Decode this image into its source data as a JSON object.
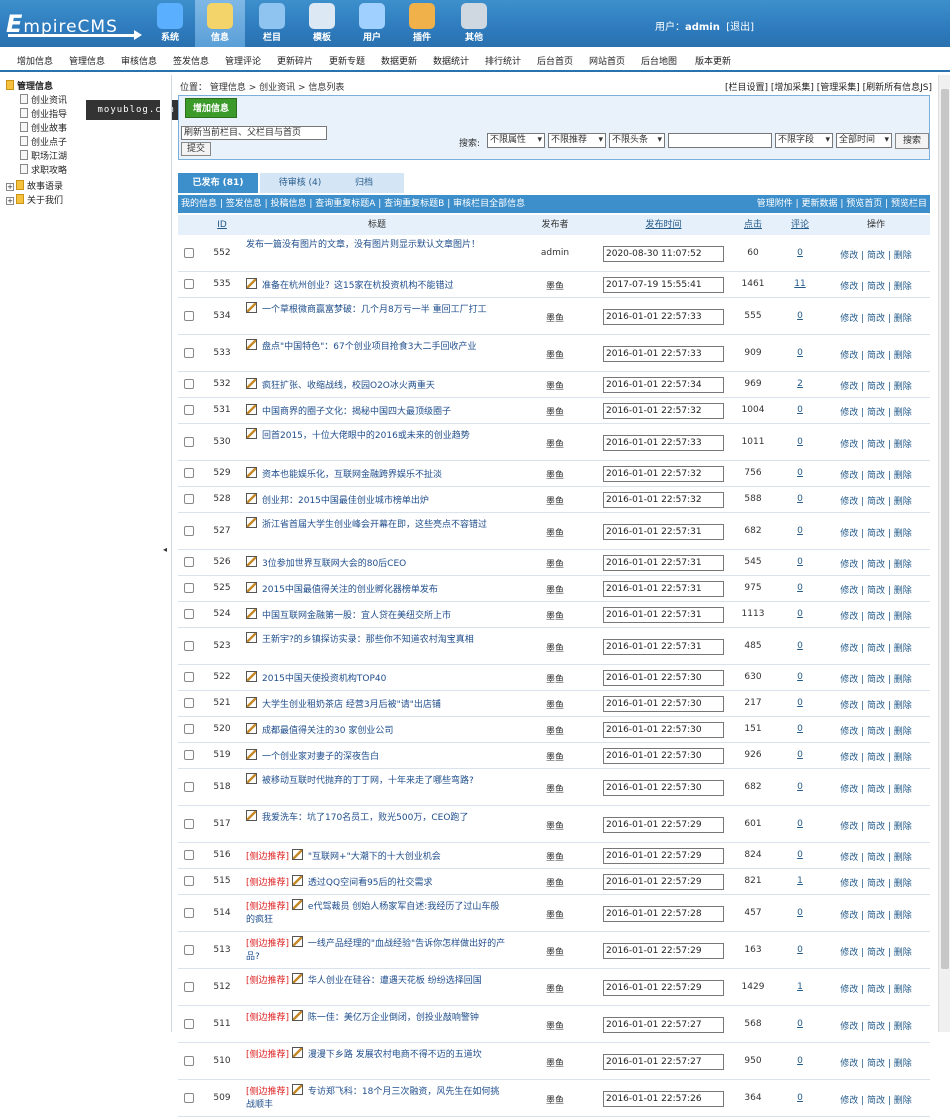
{
  "app": {
    "logo_big": "E",
    "logo_rest": "mpireCMS"
  },
  "nav": [
    {
      "label": "系统",
      "icon": "globe-icon"
    },
    {
      "label": "信息",
      "icon": "document-edit-icon"
    },
    {
      "label": "栏目",
      "icon": "folder-icon"
    },
    {
      "label": "模板",
      "icon": "template-window-icon"
    },
    {
      "label": "用户",
      "icon": "user-icon"
    },
    {
      "label": "插件",
      "icon": "tools-icon"
    },
    {
      "label": "其他",
      "icon": "gear-icon"
    }
  ],
  "user": {
    "prefix": "用户：",
    "name": "admin",
    "logout": "[退出]"
  },
  "menu": [
    "增加信息",
    "管理信息",
    "审核信息",
    "签发信息",
    "管理评论",
    "更新碎片",
    "更新专题",
    "数据更新",
    "数据统计",
    "排行统计",
    "后台首页",
    "网站首页",
    "后台地图",
    "版本更新"
  ],
  "sidebar": {
    "root": "管理信息",
    "items": [
      "创业资讯",
      "创业指导",
      "创业故事",
      "创业点子",
      "职场江湖",
      "求职攻略"
    ],
    "groups": [
      "故事语录",
      "关于我们"
    ]
  },
  "watermark": "moyublog.com",
  "breadcrumb": "位置： 管理信息 > 创业资讯 > 信息列表",
  "crumb_links": "[栏目设置] [增加采集] [管理采集] [刷新所有信息JS]",
  "toolbox": {
    "add_label": "增加信息",
    "category_select": "刷新当前栏目、父栏目与首页",
    "submit": "提交",
    "search_label": "搜索:",
    "filters": [
      "不限属性",
      "不限推荐",
      "不限头条",
      "不限字段",
      "全部时间"
    ],
    "search_value": "",
    "search_button": "搜索"
  },
  "tabs": [
    "已发布 (81)",
    "待审核 (4)",
    "归档"
  ],
  "links_left": "我的信息 | 签发信息 | 投稿信息 | 查询重复标题A | 查询重复标题B | 审核栏目全部信息",
  "links_right": "管理附件 | 更新数据 | 预览首页 | 预览栏目",
  "columns": [
    "ID",
    "标题",
    "发布者",
    "发布时间",
    "点击",
    "评论",
    "操作"
  ],
  "ops": "修改 | 简改 | 删除",
  "rows": [
    {
      "id": "552",
      "title": "发布一篇没有图片的文章，没有图片则显示默认文章图片！",
      "pen": false,
      "tag": "",
      "publisher": "admin",
      "time": "2020-08-30 11:07:52",
      "clicks": "60",
      "comments": "0"
    },
    {
      "id": "535",
      "title": "准备在杭州创业？这15家在杭投资机构不能错过",
      "pen": true,
      "tag": "",
      "publisher": "墨鱼",
      "time": "2017-07-19 15:55:41",
      "clicks": "1461",
      "comments": "11"
    },
    {
      "id": "534",
      "title": "一个草根微商赢富梦破：几个月8万亏一半 重回工厂打工",
      "pen": true,
      "tag": "",
      "publisher": "墨鱼",
      "time": "2016-01-01 22:57:33",
      "clicks": "555",
      "comments": "0"
    },
    {
      "id": "533",
      "title": "盘点\"中国特色\"：67个创业项目抢食3大二手回收产业",
      "pen": true,
      "tag": "",
      "publisher": "墨鱼",
      "time": "2016-01-01 22:57:33",
      "clicks": "909",
      "comments": "0"
    },
    {
      "id": "532",
      "title": "疯狂扩张、收缩战线，校园O2O冰火两重天",
      "pen": true,
      "tag": "",
      "publisher": "墨鱼",
      "time": "2016-01-01 22:57:34",
      "clicks": "969",
      "comments": "2"
    },
    {
      "id": "531",
      "title": "中国商界的圈子文化：揭秘中国四大最顶级圈子",
      "pen": true,
      "tag": "",
      "publisher": "墨鱼",
      "time": "2016-01-01 22:57:32",
      "clicks": "1004",
      "comments": "0"
    },
    {
      "id": "530",
      "title": "回首2015，十位大佬眼中的2016或未来的创业趋势",
      "pen": true,
      "tag": "",
      "publisher": "墨鱼",
      "time": "2016-01-01 22:57:33",
      "clicks": "1011",
      "comments": "0"
    },
    {
      "id": "529",
      "title": "资本也能娱乐化，互联网金融跨界娱乐不扯淡",
      "pen": true,
      "tag": "",
      "publisher": "墨鱼",
      "time": "2016-01-01 22:57:32",
      "clicks": "756",
      "comments": "0"
    },
    {
      "id": "528",
      "title": "创业邦：2015中国最佳创业城市榜单出炉",
      "pen": true,
      "tag": "",
      "publisher": "墨鱼",
      "time": "2016-01-01 22:57:32",
      "clicks": "588",
      "comments": "0"
    },
    {
      "id": "527",
      "title": "浙江省首届大学生创业峰会开幕在即，这些亮点不容错过",
      "pen": true,
      "tag": "",
      "publisher": "墨鱼",
      "time": "2016-01-01 22:57:31",
      "clicks": "682",
      "comments": "0"
    },
    {
      "id": "526",
      "title": "3位参加世界互联网大会的80后CEO",
      "pen": true,
      "tag": "",
      "publisher": "墨鱼",
      "time": "2016-01-01 22:57:31",
      "clicks": "545",
      "comments": "0"
    },
    {
      "id": "525",
      "title": "2015中国最值得关注的创业孵化器榜单发布",
      "pen": true,
      "tag": "",
      "publisher": "墨鱼",
      "time": "2016-01-01 22:57:31",
      "clicks": "975",
      "comments": "0"
    },
    {
      "id": "524",
      "title": "中国互联网金融第一股：宜人贷在美纽交所上市",
      "pen": true,
      "tag": "",
      "publisher": "墨鱼",
      "time": "2016-01-01 22:57:31",
      "clicks": "1113",
      "comments": "0"
    },
    {
      "id": "523",
      "title": "王新宇?的乡镇探访实录：那些你不知道农村淘宝真相",
      "pen": true,
      "tag": "",
      "publisher": "墨鱼",
      "time": "2016-01-01 22:57:31",
      "clicks": "485",
      "comments": "0"
    },
    {
      "id": "522",
      "title": "2015中国天使投资机构TOP40",
      "pen": true,
      "tag": "",
      "publisher": "墨鱼",
      "time": "2016-01-01 22:57:30",
      "clicks": "630",
      "comments": "0"
    },
    {
      "id": "521",
      "title": "大学生创业租奶茶店 经营3月后被\"请\"出店铺",
      "pen": true,
      "tag": "",
      "publisher": "墨鱼",
      "time": "2016-01-01 22:57:30",
      "clicks": "217",
      "comments": "0"
    },
    {
      "id": "520",
      "title": "成都最值得关注的30 家创业公司",
      "pen": true,
      "tag": "",
      "publisher": "墨鱼",
      "time": "2016-01-01 22:57:30",
      "clicks": "151",
      "comments": "0"
    },
    {
      "id": "519",
      "title": "一个创业家对妻子的深夜告白",
      "pen": true,
      "tag": "",
      "publisher": "墨鱼",
      "time": "2016-01-01 22:57:30",
      "clicks": "926",
      "comments": "0"
    },
    {
      "id": "518",
      "title": "被移动互联时代抛弃的丁丁网，十年来走了哪些弯路?",
      "pen": true,
      "tag": "",
      "publisher": "墨鱼",
      "time": "2016-01-01 22:57:30",
      "clicks": "682",
      "comments": "0"
    },
    {
      "id": "517",
      "title": "我爱洗车：坑了170名员工，败光500万，CEO跑了",
      "pen": true,
      "tag": "",
      "publisher": "墨鱼",
      "time": "2016-01-01 22:57:29",
      "clicks": "601",
      "comments": "0"
    },
    {
      "id": "516",
      "title": "\"互联网+\"大潮下的十大创业机会",
      "pen": true,
      "tag": "[侧边推荐]",
      "publisher": "墨鱼",
      "time": "2016-01-01 22:57:29",
      "clicks": "824",
      "comments": "0"
    },
    {
      "id": "515",
      "title": "透过QQ空间看95后的社交需求",
      "pen": true,
      "tag": "[侧边推荐]",
      "publisher": "墨鱼",
      "time": "2016-01-01 22:57:29",
      "clicks": "821",
      "comments": "1"
    },
    {
      "id": "514",
      "title": "e代驾裁员 创始人杨家军自述:我经历了过山车般的疯狂",
      "pen": true,
      "tag": "[侧边推荐]",
      "publisher": "墨鱼",
      "time": "2016-01-01 22:57:28",
      "clicks": "457",
      "comments": "0"
    },
    {
      "id": "513",
      "title": "一线产品经理的\"血战经验\"告诉你怎样做出好的产品?",
      "pen": true,
      "tag": "[侧边推荐]",
      "publisher": "墨鱼",
      "time": "2016-01-01 22:57:29",
      "clicks": "163",
      "comments": "0"
    },
    {
      "id": "512",
      "title": "华人创业在硅谷：遭遇天花板 纷纷选择回国",
      "pen": true,
      "tag": "[侧边推荐]",
      "publisher": "墨鱼",
      "time": "2016-01-01 22:57:29",
      "clicks": "1429",
      "comments": "1"
    },
    {
      "id": "511",
      "title": "陈一佳：美亿万企业倒闭，创投业敲响警钟",
      "pen": true,
      "tag": "[侧边推荐]",
      "publisher": "墨鱼",
      "time": "2016-01-01 22:57:27",
      "clicks": "568",
      "comments": "0"
    },
    {
      "id": "510",
      "title": "漫漫下乡路 发展农村电商不得不迈的五道坎",
      "pen": true,
      "tag": "[侧边推荐]",
      "publisher": "墨鱼",
      "time": "2016-01-01 22:57:27",
      "clicks": "950",
      "comments": "0"
    },
    {
      "id": "509",
      "title": "专访郑飞科：18个月三次融资，风先生在如何挑战顺丰",
      "pen": true,
      "tag": "[侧边推荐]",
      "publisher": "墨鱼",
      "time": "2016-01-01 22:57:26",
      "clicks": "364",
      "comments": "0"
    }
  ]
}
